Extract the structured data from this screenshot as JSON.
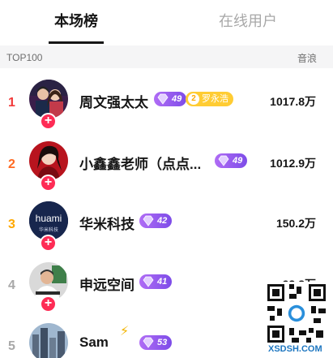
{
  "tabs": {
    "active": "本场榜",
    "inactive": "在线用户"
  },
  "list_header": {
    "left": "TOP100",
    "right": "音浪"
  },
  "colors": {
    "rank1": "#f23a3a",
    "rank2": "#ff6a22",
    "rank3": "#ffa800",
    "rank_other": "#a8a8a8",
    "follow": "#fe2c55",
    "level_badge": "#8c55ee",
    "fan_badge": "#ffcc33"
  },
  "rows": [
    {
      "rank": "1",
      "name": "周文强太太",
      "level": "49",
      "fan_badge": "罗永浩",
      "fan_level": "2",
      "value": "1017.8万",
      "avatar_icon": "avatar-couple"
    },
    {
      "rank": "2",
      "name": "小鑫鑫老师（点点...",
      "level": "49",
      "value": "1012.9万",
      "avatar_icon": "avatar-woman"
    },
    {
      "rank": "3",
      "name": "华米科技",
      "level": "42",
      "value": "150.2万",
      "avatar_icon": "avatar-huami-logo",
      "avatar_text": "huami",
      "avatar_subtext": "华米科技"
    },
    {
      "rank": "4",
      "name": "申远空间",
      "level": "41",
      "value": "93.8万",
      "avatar_icon": "avatar-man"
    },
    {
      "rank": "5",
      "name": "Sam",
      "level": "53",
      "value": "",
      "avatar_icon": "avatar-city"
    }
  ],
  "watermark": {
    "caption": "XSDSH.COM"
  }
}
